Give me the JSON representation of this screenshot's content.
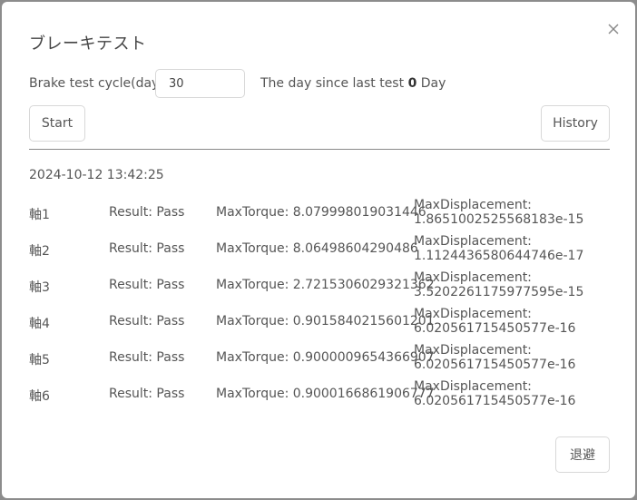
{
  "dialog": {
    "title": "ブレーキテスト",
    "close_glyph": "×"
  },
  "settings": {
    "cycle_label": "Brake test cycle(day)",
    "cycle_value": "30",
    "since_prefix": "The day since last test",
    "since_value": "0",
    "since_unit": "Day"
  },
  "buttons": {
    "start": "Start",
    "history": "History",
    "exit": "退避"
  },
  "results": {
    "timestamp": "2024-10-12 13:42:25",
    "rows": [
      {
        "axis": "軸1",
        "result": "Result: Pass",
        "torque": "MaxTorque: 8.079998019031446",
        "disp_label": "MaxDisplacement:",
        "disp_value": "1.8651002525568183e-15"
      },
      {
        "axis": "軸2",
        "result": "Result: Pass",
        "torque": "MaxTorque: 8.06498604290486",
        "disp_label": "MaxDisplacement:",
        "disp_value": "1.1124436580644746e-17"
      },
      {
        "axis": "軸3",
        "result": "Result: Pass",
        "torque": "MaxTorque: 2.7215306029321362",
        "disp_label": "MaxDisplacement:",
        "disp_value": "3.5202261175977595e-15"
      },
      {
        "axis": "軸4",
        "result": "Result: Pass",
        "torque": "MaxTorque: 0.9015840215601201",
        "disp_label": "MaxDisplacement:",
        "disp_value": "6.020561715450577e-16"
      },
      {
        "axis": "軸5",
        "result": "Result: Pass",
        "torque": "MaxTorque: 0.9000009654366907",
        "disp_label": "MaxDisplacement:",
        "disp_value": "6.020561715450577e-16"
      },
      {
        "axis": "軸6",
        "result": "Result: Pass",
        "torque": "MaxTorque: 0.9000166861906777",
        "disp_label": "MaxDisplacement:",
        "disp_value": "6.020561715450577e-16"
      }
    ]
  }
}
